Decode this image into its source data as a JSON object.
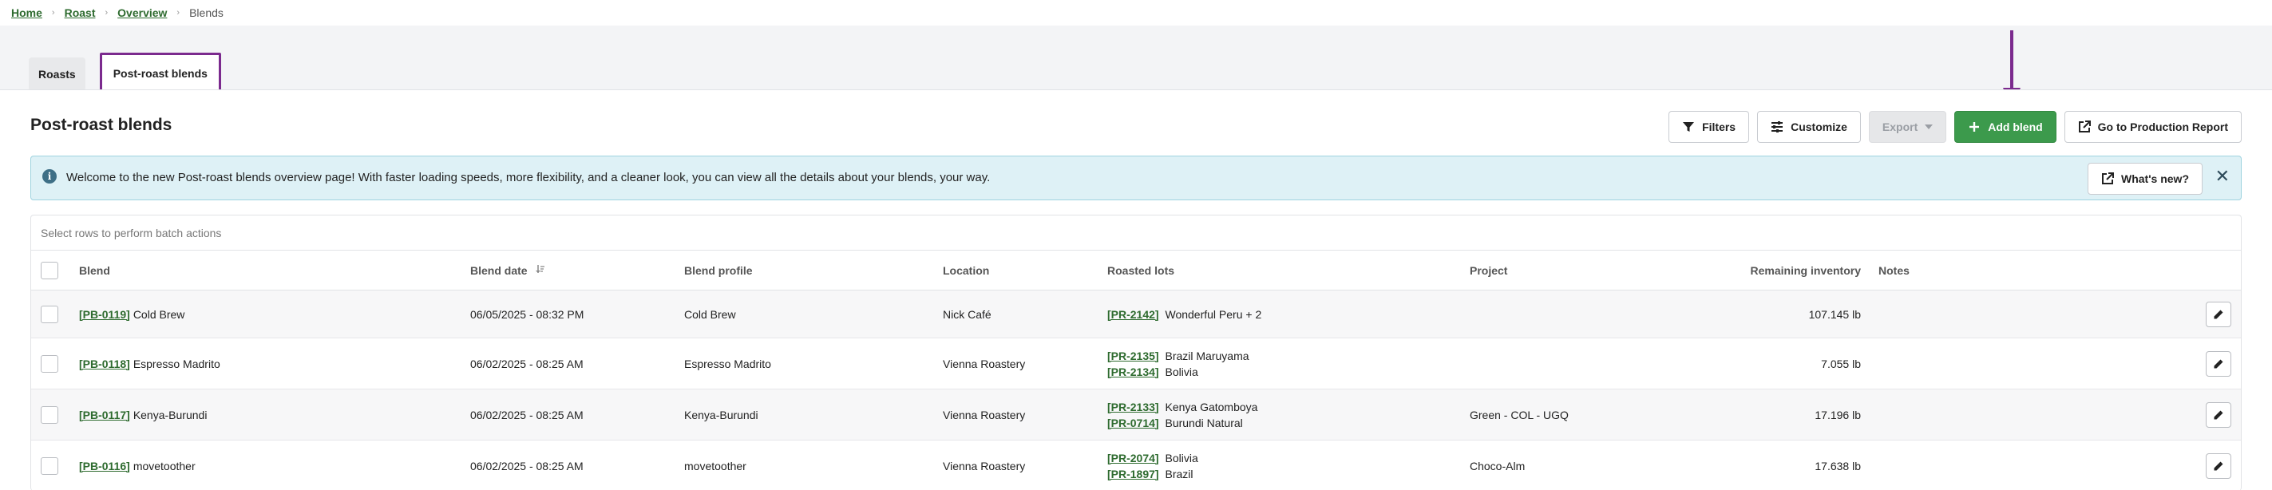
{
  "breadcrumb": {
    "items": [
      "Home",
      "Roast",
      "Overview"
    ],
    "current": "Blends",
    "separator": "›"
  },
  "tabs": [
    {
      "label": "Roasts",
      "active": false
    },
    {
      "label": "Post-roast blends",
      "active": true
    }
  ],
  "page": {
    "title": "Post-roast blends"
  },
  "toolbar": {
    "filters": "Filters",
    "customize": "Customize",
    "export": "Export",
    "add": "Add blend",
    "report": "Go to Production Report"
  },
  "banner": {
    "message": "Welcome to the new Post-roast blends overview page! With faster loading speeds, more flexibility, and a cleaner look, you can view all the details about your blends, your way.",
    "whats_new": "What's new?",
    "info_glyph": "i",
    "close_glyph": "✕"
  },
  "table": {
    "batch_hint": "Select rows to perform batch actions",
    "columns": {
      "blend": "Blend",
      "blend_date": "Blend date",
      "blend_profile": "Blend profile",
      "location": "Location",
      "roasted_lots": "Roasted lots",
      "project": "Project",
      "remaining": "Remaining inventory",
      "notes": "Notes"
    },
    "rows": [
      {
        "code": "[PB-0119]",
        "name": "Cold Brew",
        "date": "06/05/2025 - 08:32 PM",
        "profile": "Cold Brew",
        "location": "Nick Café",
        "lots": [
          {
            "code": "[PR-2142]",
            "name": "Wonderful Peru + 2"
          }
        ],
        "project": "",
        "remaining": "107.145 lb",
        "notes": ""
      },
      {
        "code": "[PB-0118]",
        "name": "Espresso Madrito",
        "date": "06/02/2025 - 08:25 AM",
        "profile": "Espresso Madrito",
        "location": "Vienna Roastery",
        "lots": [
          {
            "code": "[PR-2135]",
            "name": "Brazil Maruyama"
          },
          {
            "code": "[PR-2134]",
            "name": "Bolivia"
          }
        ],
        "project": "",
        "remaining": "7.055 lb",
        "notes": ""
      },
      {
        "code": "[PB-0117]",
        "name": "Kenya-Burundi",
        "date": "06/02/2025 - 08:25 AM",
        "profile": "Kenya-Burundi",
        "location": "Vienna Roastery",
        "lots": [
          {
            "code": "[PR-2133]",
            "name": "Kenya Gatomboya"
          },
          {
            "code": "[PR-0714]",
            "name": "Burundi Natural"
          }
        ],
        "project": "Green - COL - UGQ",
        "remaining": "17.196 lb",
        "notes": ""
      },
      {
        "code": "[PB-0116]",
        "name": "movetoother",
        "date": "06/02/2025 - 08:25 AM",
        "profile": "movetoother",
        "location": "Vienna Roastery",
        "lots": [
          {
            "code": "[PR-2074]",
            "name": "Bolivia"
          },
          {
            "code": "[PR-1897]",
            "name": "Brazil"
          }
        ],
        "project": "Choco-Alm",
        "remaining": "17.638 lb",
        "notes": ""
      }
    ]
  },
  "colors": {
    "accent_green": "#3c9a4c",
    "link_green": "#2e6b2f",
    "annotation_purple": "#7b2a8e",
    "banner_bg": "#def1f6"
  }
}
